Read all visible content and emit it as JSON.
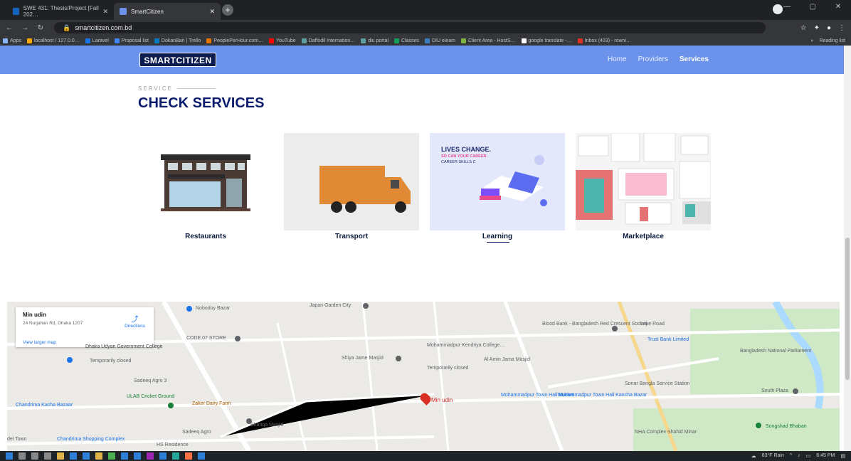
{
  "browser": {
    "tabs": [
      {
        "title": "SWE 431: Thesis/Project [Fall 202…",
        "active": false
      },
      {
        "title": "SmartCitizen",
        "active": true
      }
    ],
    "url": "smartcitizen.com.bd",
    "bookmarks": [
      "Apps",
      "localhost / 127.0.0…",
      "Laravel",
      "Proposal list",
      "DokanBari | Trello",
      "PeoplePerHour.com…",
      "YouTube",
      "Daffodil Internation…",
      "diu portal",
      "Classes",
      "DIU eleam",
      "Client Area - HostS…",
      "google translate -…",
      "Inbox (403) - rowni…"
    ],
    "bookmarks_more": "»",
    "reading_list": "Reading list"
  },
  "site": {
    "logo": "SMARTCITIZEN",
    "nav": [
      "Home",
      "Providers",
      "Services"
    ],
    "kicker": "SERVICE",
    "title": "CHECK SERVICES",
    "cards": [
      {
        "label": "Restaurants"
      },
      {
        "label": "Transport"
      },
      {
        "label": "Learning",
        "banner1": "LIVES CHANGE.",
        "banner2": "SO CAN YOUR CAREER.",
        "banner3": "CAREER SKILLS C"
      },
      {
        "label": "Marketplace"
      }
    ]
  },
  "map": {
    "info_name": "Min udin",
    "info_address": "24 Nurjahan Rd, Dhaka 1207",
    "view_larger": "View larger map",
    "directions": "Directions",
    "pin_label": "Min udin",
    "labels": [
      "Nobodoy Bazar",
      "Japan Garden City",
      "CODE 07 STORE",
      "Dhaka Udyan Government College",
      "Temporarily closed",
      "Shiya Jame Masjid",
      "Mohammadpur Kendriya College…",
      "Temporarily closed",
      "Al Amin Jama Masjid",
      "Blood Bank - Bangladesh Red Crescent Society",
      "Lake Road",
      "Trust Bank Limited",
      "Bangladesh National Parliament",
      "Sadeeq Agro 3",
      "ULAB Cricket Ground",
      "Zaker Dairy Farm",
      "Chandrima Kacha Bazaar",
      "Bhanga Masjid",
      "Sadeeq Agro",
      "Mohammadpur Town Hall Market",
      "Muhammadpur Town Hall Kancha Bazar",
      "Sonar Bangla Service Station",
      "South Plaza",
      "NHA Complex Shahid Minar",
      "Songshad Bhaban",
      "HS Residence",
      "Chandrima Shopping Complex",
      "del Town"
    ]
  },
  "taskbar": {
    "weather": "83°F Rain",
    "time": "6:45 PM"
  }
}
